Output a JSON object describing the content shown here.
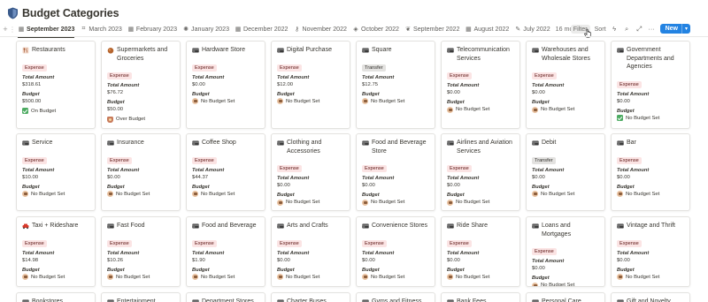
{
  "page": {
    "title": "Budget Categories",
    "icon": "shield-icon"
  },
  "tabs": [
    {
      "label": "September 2023",
      "icon": "calendar-icon",
      "active": true
    },
    {
      "label": "March 2023",
      "icon": "grid-icon"
    },
    {
      "label": "February 2023",
      "icon": "calendar-icon"
    },
    {
      "label": "January 2023",
      "icon": "sun-icon"
    },
    {
      "label": "December 2022",
      "icon": "calendar-icon"
    },
    {
      "label": "November 2022",
      "icon": "key-icon"
    },
    {
      "label": "October 2022",
      "icon": "tag-icon"
    },
    {
      "label": "September 2022",
      "icon": "leaf-icon"
    },
    {
      "label": "August 2022",
      "icon": "calendar-icon"
    },
    {
      "label": "July 2022",
      "icon": "pencil-icon"
    }
  ],
  "tabs_more": "16 more...",
  "toolbar": {
    "filter_label": "Filter",
    "sort_label": "Sort",
    "new_label": "New"
  },
  "labels": {
    "total": "Total Amount",
    "budget": "Budget"
  },
  "colors": {
    "accent": "#2383e2",
    "expense_bg": "#fbe4e4",
    "transfer_bg": "#e3e2e0",
    "on_budget": "#4dab62"
  },
  "cards": [
    {
      "name": "Restaurants",
      "icon": "restaurant-icon",
      "tag": "Expense",
      "total": "$318.61",
      "budget": "$500.00",
      "status": "On Budget",
      "status_icon": "check-icon"
    },
    {
      "name": "Supermarkets and Groceries",
      "icon": "grocery-icon",
      "tag": "Expense",
      "total": "$76.72",
      "budget": "$50.00",
      "status": "Over Budget",
      "status_icon": "bag-icon"
    },
    {
      "name": "Hardware Store",
      "icon": "card-icon",
      "tag": "Expense",
      "total": "$0.00",
      "budget": null,
      "status": "No Budget Set",
      "status_icon": "money-icon"
    },
    {
      "name": "Digital Purchase",
      "icon": "card-icon",
      "tag": "Expense",
      "total": "$12.00",
      "budget": null,
      "status": "No Budget Set",
      "status_icon": "money-icon"
    },
    {
      "name": "Square",
      "icon": "card-icon",
      "tag": "Transfer",
      "total": "$12.75",
      "budget": null,
      "status": "No Budget Set",
      "status_icon": "money-icon"
    },
    {
      "name": "Telecommunication Services",
      "icon": "card-icon",
      "tag": "Expense",
      "total": "$0.00",
      "budget": null,
      "status": "No Budget Set",
      "status_icon": "money-icon"
    },
    {
      "name": "Warehouses and Wholesale Stores",
      "icon": "card-icon",
      "tag": "Expense",
      "total": "$0.00",
      "budget": null,
      "status": "No Budget Set",
      "status_icon": "money-icon"
    },
    {
      "name": "Government Departments and Agencies",
      "icon": "card-icon",
      "tag": "Expense",
      "total": "$0.00",
      "budget": null,
      "status": "No Budget Set",
      "status_icon": "check-icon"
    },
    {
      "name": "Service",
      "icon": "card-icon",
      "tag": "Expense",
      "total": "$10.00",
      "budget": null,
      "status": "No Budget Set",
      "status_icon": "money-icon"
    },
    {
      "name": "Insurance",
      "icon": "card-icon",
      "tag": "Expense",
      "total": "$0.00",
      "budget": null,
      "status": "No Budget Set",
      "status_icon": "money-icon"
    },
    {
      "name": "Coffee Shop",
      "icon": "card-icon",
      "tag": "Expense",
      "total": "$44.37",
      "budget": null,
      "status": "No Budget Set",
      "status_icon": "money-icon"
    },
    {
      "name": "Clothing and Accessories",
      "icon": "card-icon",
      "tag": "Expense",
      "total": "$0.00",
      "budget": null,
      "status": "No Budget Set",
      "status_icon": "money-icon"
    },
    {
      "name": "Food and Beverage Store",
      "icon": "card-icon",
      "tag": "Expense",
      "total": "$0.00",
      "budget": null,
      "status": "No Budget Set",
      "status_icon": "money-icon"
    },
    {
      "name": "Airlines and Aviation Services",
      "icon": "card-icon",
      "tag": "Expense",
      "total": "$0.00",
      "budget": null,
      "status": "No Budget Set",
      "status_icon": "money-icon"
    },
    {
      "name": "Debit",
      "icon": "card-icon",
      "tag": "Transfer",
      "total": "$0.00",
      "budget": null,
      "status": "No Budget Set",
      "status_icon": "money-icon"
    },
    {
      "name": "Bar",
      "icon": "card-icon",
      "tag": "Expense",
      "total": "$0.00",
      "budget": null,
      "status": "No Budget Set",
      "status_icon": "money-icon"
    },
    {
      "name": "Taxi + Rideshare",
      "icon": "taxi-icon",
      "tag": "Expense",
      "total": "$14.98",
      "budget": null,
      "status": "No Budget Set",
      "status_icon": "money-icon"
    },
    {
      "name": "Fast Food",
      "icon": "card-icon",
      "tag": "Expense",
      "total": "$10.26",
      "budget": null,
      "status": "No Budget Set",
      "status_icon": "money-icon"
    },
    {
      "name": "Food and Beverage",
      "icon": "card-icon",
      "tag": "Expense",
      "total": "$1.90",
      "budget": null,
      "status": "No Budget Set",
      "status_icon": "money-icon"
    },
    {
      "name": "Arts and Crafts",
      "icon": "card-icon",
      "tag": "Expense",
      "total": "$0.00",
      "budget": null,
      "status": "No Budget Set",
      "status_icon": "money-icon"
    },
    {
      "name": "Convenience Stores",
      "icon": "card-icon",
      "tag": "Expense",
      "total": "$0.00",
      "budget": null,
      "status": "No Budget Set",
      "status_icon": "money-icon"
    },
    {
      "name": "Ride Share",
      "icon": "card-icon",
      "tag": "Expense",
      "total": "$0.00",
      "budget": null,
      "status": "No Budget Set",
      "status_icon": "money-icon"
    },
    {
      "name": "Loans and Mortgages",
      "icon": "card-icon",
      "tag": "Expense",
      "total": "$0.00",
      "budget": null,
      "status": "No Budget Set",
      "status_icon": "money-icon"
    },
    {
      "name": "Vintage and Thrift",
      "icon": "card-icon",
      "tag": "Expense",
      "total": "$0.00",
      "budget": null,
      "status": "No Budget Set",
      "status_icon": "money-icon"
    },
    {
      "name": "Bookstores",
      "icon": "card-icon"
    },
    {
      "name": "Entertainment",
      "icon": "card-icon"
    },
    {
      "name": "Department Stores",
      "icon": "card-icon"
    },
    {
      "name": "Charter Buses",
      "icon": "card-icon"
    },
    {
      "name": "Gyms and Fitness",
      "icon": "card-icon"
    },
    {
      "name": "Bank Fees",
      "icon": "card-icon"
    },
    {
      "name": "Personal Care",
      "icon": "card-icon"
    },
    {
      "name": "Gift and Novelty",
      "icon": "card-icon"
    }
  ]
}
